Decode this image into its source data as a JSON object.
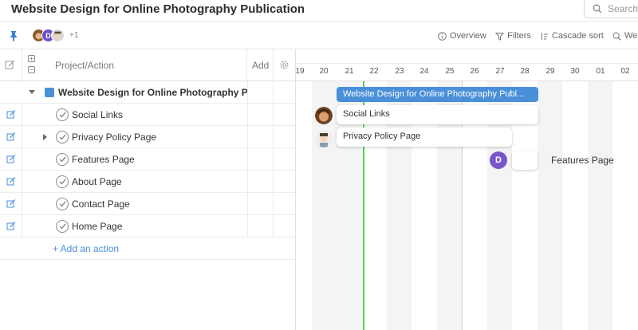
{
  "header": {
    "title": "Website Design for Online Photography Publication",
    "search_placeholder": "Search"
  },
  "toolbar": {
    "more_members": "+1",
    "overview": "Overview",
    "filters": "Filters",
    "cascade_sort": "Cascade sort",
    "zoom_label": "We"
  },
  "grid": {
    "column_project": "Project/Action",
    "column_add": "Add",
    "project_name": "Website Design for Online Photography Pu",
    "tasks": [
      {
        "label": "Social Links"
      },
      {
        "label": "Privacy Policy Page"
      },
      {
        "label": "Features Page"
      },
      {
        "label": "About Page"
      },
      {
        "label": "Contact Page"
      },
      {
        "label": "Home Page"
      }
    ],
    "add_action": "+ Add an action"
  },
  "gantt": {
    "days": [
      "19",
      "20",
      "21",
      "22",
      "23",
      "24",
      "25",
      "26",
      "27",
      "28",
      "29",
      "30",
      "01",
      "02"
    ],
    "project_bar": "Website Design for Online Photography Publ...",
    "bars": {
      "social_links": "Social Links",
      "privacy_policy": "Privacy Policy Page",
      "features_page": "Features Page"
    },
    "assignee_initial": "D"
  },
  "colors": {
    "accent": "#4a8fd9",
    "today_line": "#4cd34c",
    "avatar_purple": "#7a55c8"
  }
}
